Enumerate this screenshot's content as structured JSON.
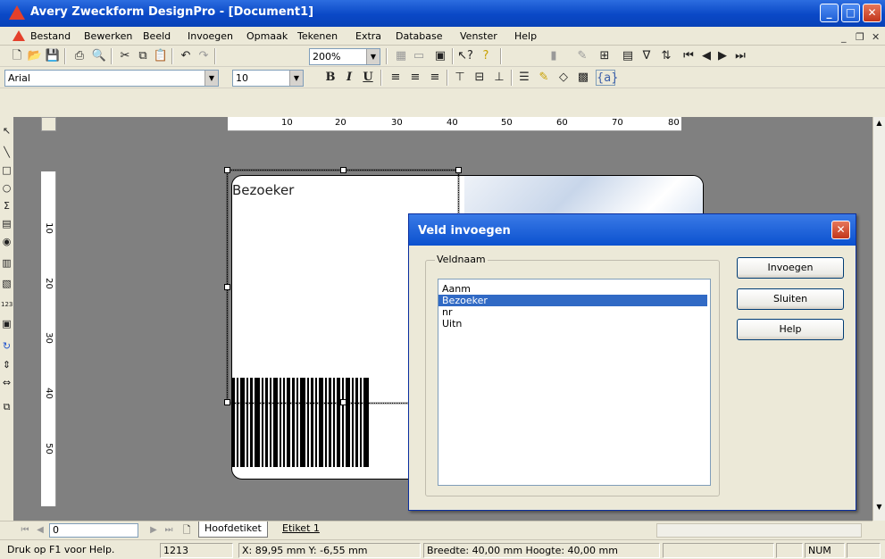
{
  "window": {
    "title": "Avery Zweckform DesignPro - [Document1]",
    "min_icon": "minimize-icon",
    "max_icon": "maximize-icon",
    "close_icon": "close-icon"
  },
  "menu": {
    "items": [
      "Bestand",
      "Bewerken",
      "Beeld",
      "Invoegen",
      "Opmaak",
      "Tekenen",
      "Extra",
      "Database",
      "Venster",
      "Help"
    ]
  },
  "toolbar": {
    "zoom": "200%",
    "font": "Arial",
    "size": "10",
    "bold": "B",
    "italic": "I",
    "underline": "U",
    "field_token": "{a}"
  },
  "ruler": {
    "h": [
      "10",
      "20",
      "30",
      "40",
      "50",
      "60",
      "70",
      "80"
    ],
    "v": [
      "10",
      "20",
      "30",
      "40",
      "50"
    ]
  },
  "label": {
    "field_text": "Bezoeker"
  },
  "dialog": {
    "title": "Veld invoegen",
    "group_label": "Veldnaam",
    "fields": [
      "Aanm",
      "Bezoeker",
      "nr",
      "Uitn"
    ],
    "selected_index": 1,
    "btn_insert": "Invoegen",
    "btn_close": "Sluiten",
    "btn_help": "Help"
  },
  "tabs": {
    "page_field": "0",
    "tab1": "Hoofdetiket",
    "tab2": "Etiket 1"
  },
  "status": {
    "help": "Druk op F1 voor Help.",
    "count": "1213",
    "coords": "X: 89,95 mm  Y: -6,55 mm",
    "dims": "Breedte: 40,00 mm  Hoogte: 40,00 mm",
    "num": "NUM"
  },
  "colors": {
    "titlebar": "#0a48c6",
    "selection": "#316ac5",
    "workspace": "#808080"
  }
}
